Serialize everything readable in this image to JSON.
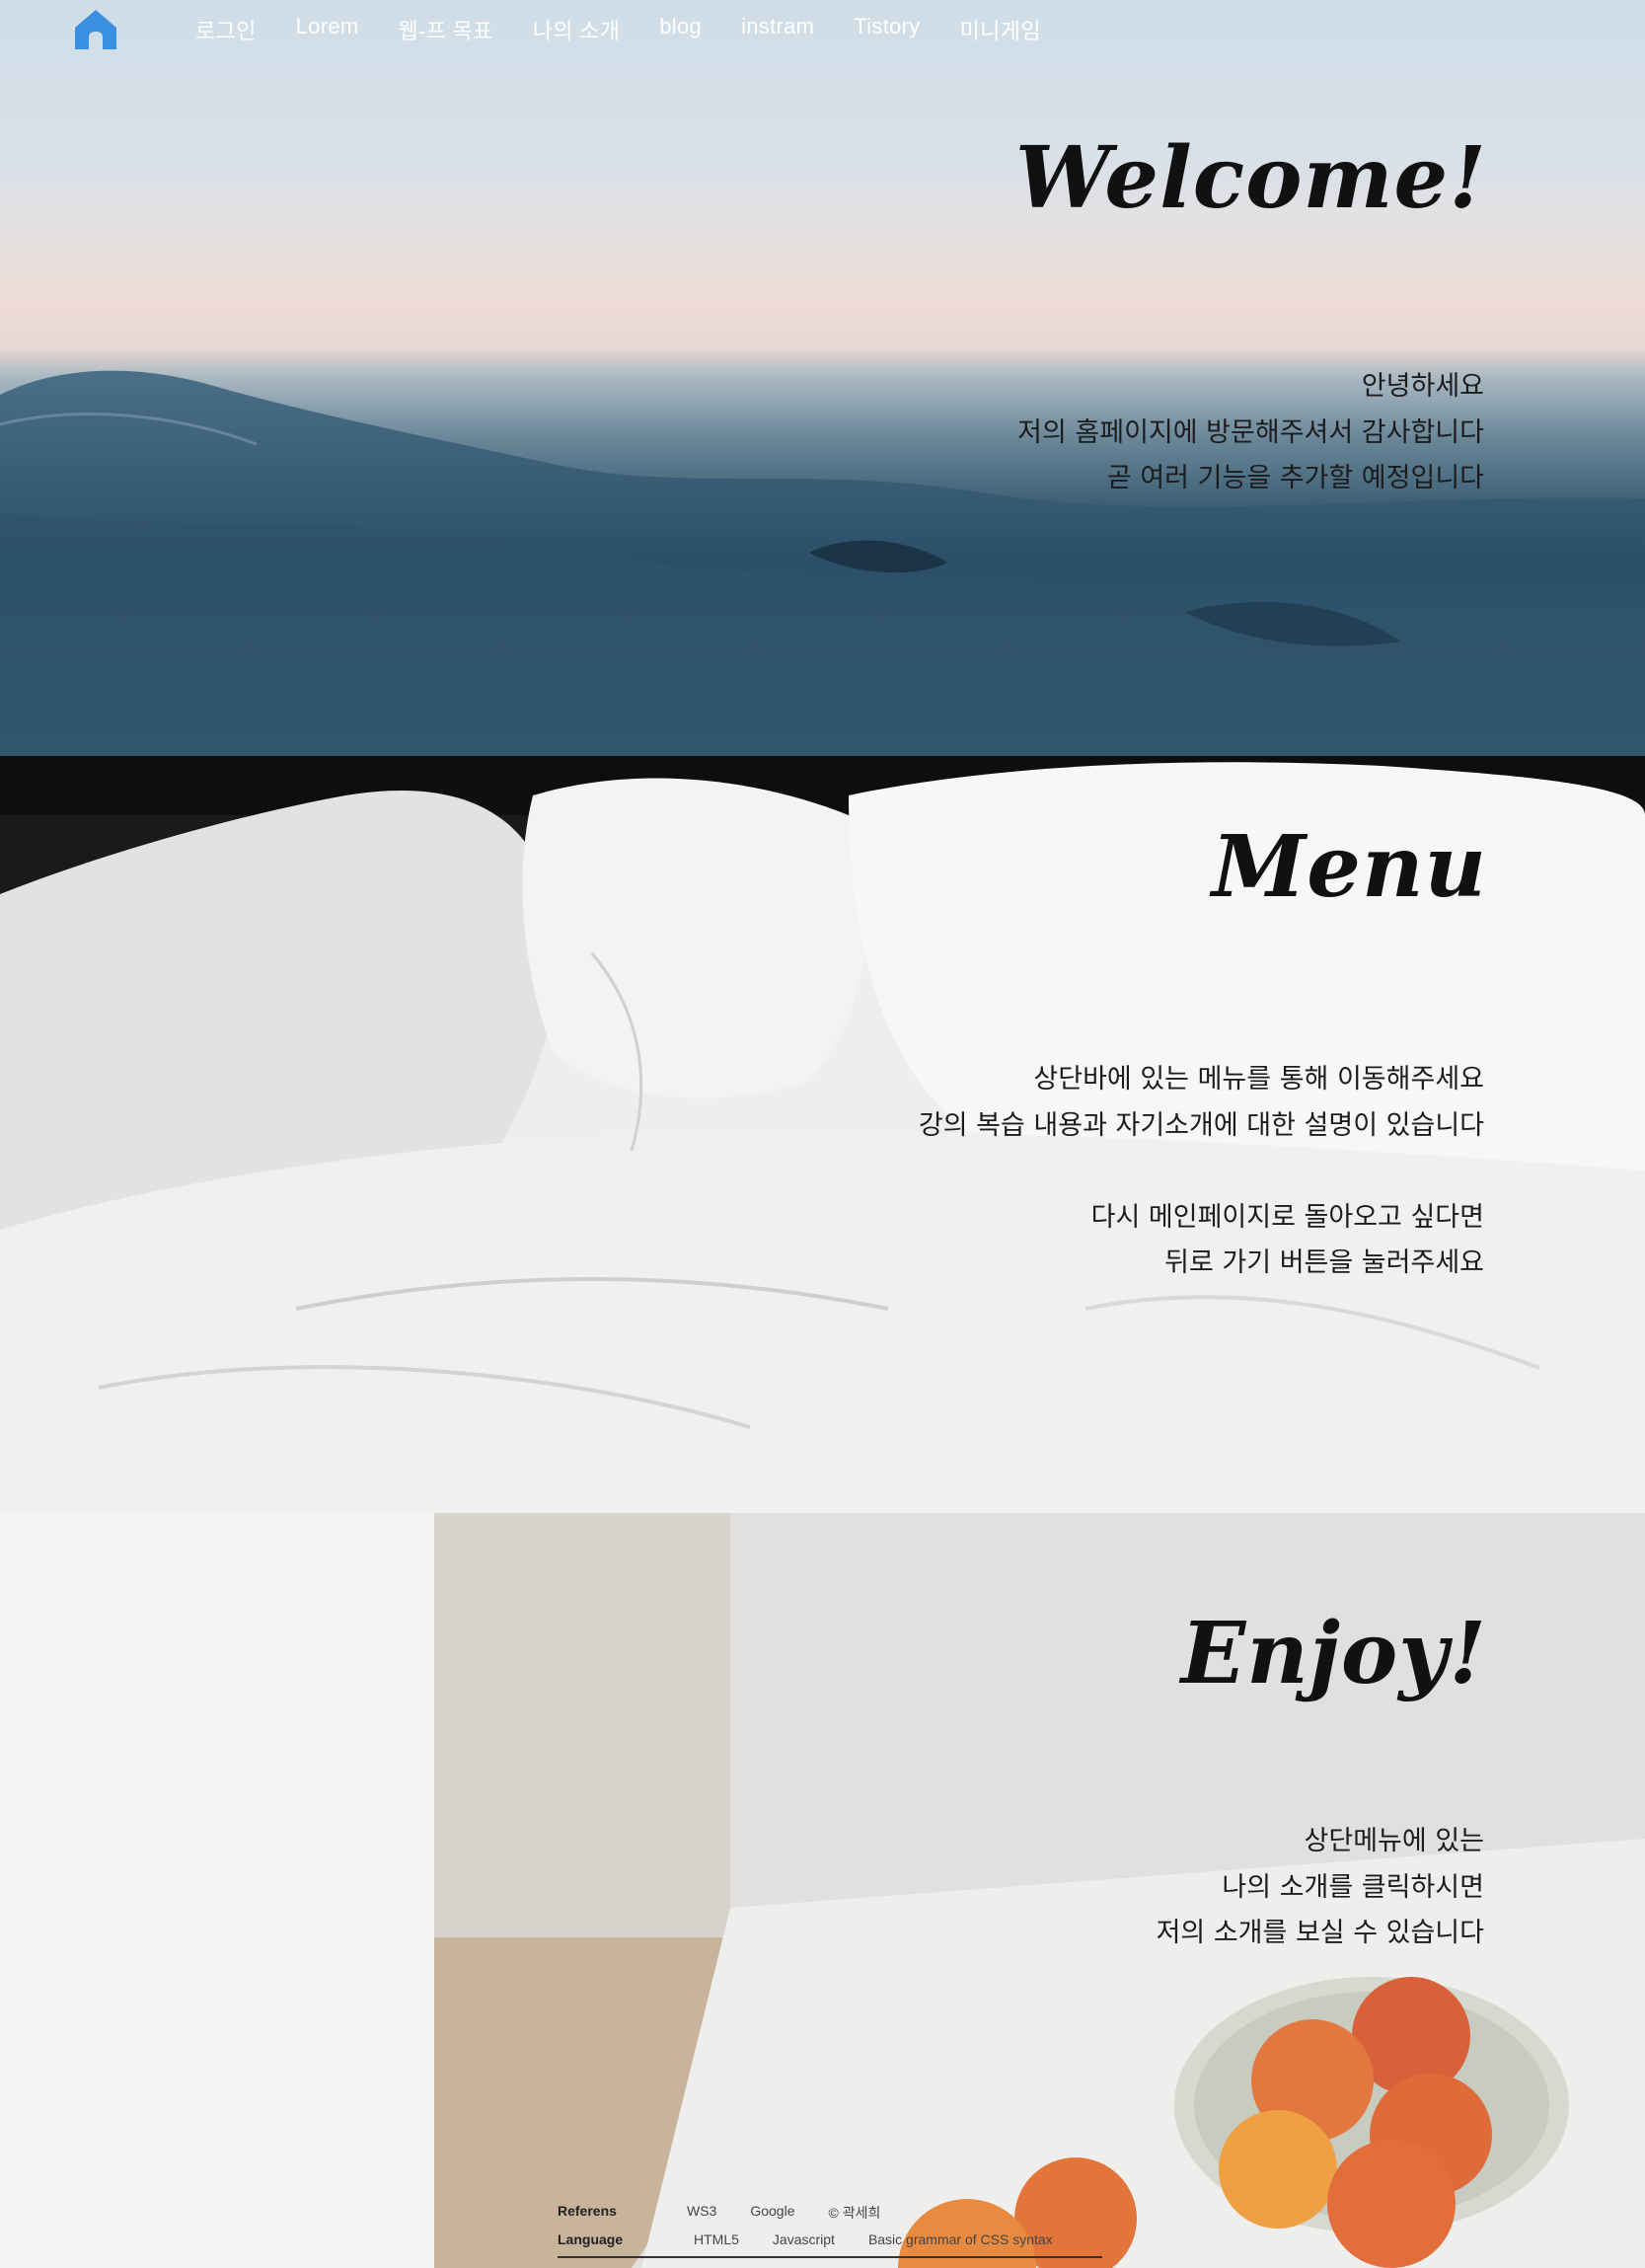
{
  "nav": {
    "home_icon": "home-icon",
    "links": [
      "로그인",
      "Lorem",
      "웹-프 목표",
      "나의 소개",
      "blog",
      "instram",
      "Tistory",
      "미니게임"
    ]
  },
  "sections": [
    {
      "heading": "Welcome!",
      "lines": [
        "안녕하세요",
        "저의 홈페이지에 방문해주셔서 감사합니다",
        "곧 여러 기능을 추가할 예정입니다"
      ]
    },
    {
      "heading": "Menu",
      "lines": [
        "상단바에 있는 메뉴를 통해 이동해주세요",
        "강의 복습 내용과 자기소개에 대한 설명이 있습니다",
        "",
        "다시 메인페이지로 돌아오고 싶다면",
        "뒤로 가기 버튼을 눌러주세요"
      ]
    },
    {
      "heading": "Enjoy!",
      "lines": [
        "상단메뉴에 있는",
        "나의 소개를 클릭하시면",
        "저의 소개를 보실 수 있습니다"
      ]
    }
  ],
  "footer": {
    "rows": [
      {
        "label": "Referens",
        "items": [
          "WS3",
          "Google",
          "© 곽세희"
        ]
      },
      {
        "label": "Language",
        "items": [
          "HTML5",
          "Javascript",
          "Basic grammar of CSS syntax"
        ]
      }
    ]
  },
  "colors": {
    "home_icon": "#3b8fe0",
    "text": "#1c1c1c"
  }
}
